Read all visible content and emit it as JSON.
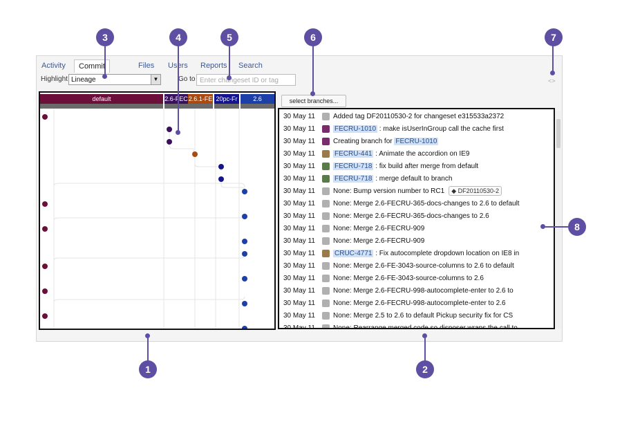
{
  "tabs": [
    "Activity",
    "Commit Graph",
    "Files",
    "Users",
    "Reports",
    "Search"
  ],
  "toolbar": {
    "highlight_label": "Highlight",
    "highlight_value": "Lineage",
    "goto_label": "Go to",
    "goto_placeholder": "Enter changeset ID or tag",
    "select_branches": "select branches..."
  },
  "branches": [
    {
      "label": "default",
      "color": "#6b0f3a"
    },
    {
      "label": "2.6-FEC",
      "color": "#3a0f5e"
    },
    {
      "label": "2.6.1-FE",
      "color": "#a84a12"
    },
    {
      "label": "20pc-Fr",
      "color": "#14148c"
    },
    {
      "label": "2.6",
      "color": "#1c3fa8"
    }
  ],
  "commits": [
    {
      "date": "30 May 11",
      "avatar": "gray",
      "pre": "Added tag DF20110530-2 for changeset e315533a2372",
      "key": "",
      "post": "",
      "tag": ""
    },
    {
      "date": "30 May 11",
      "avatar": "purple",
      "pre": "",
      "key": "FECRU-1010",
      "post": " : make isUserInGroup call the cache first",
      "tag": ""
    },
    {
      "date": "30 May 11",
      "avatar": "purple",
      "pre": "Creating branch for ",
      "key": "FECRU-1010",
      "post": "",
      "tag": ""
    },
    {
      "date": "30 May 11",
      "avatar": "brown",
      "pre": "",
      "key": "FECRU-441",
      "post": " : Animate the accordion on IE9",
      "tag": ""
    },
    {
      "date": "30 May 11",
      "avatar": "green",
      "pre": "",
      "key": "FECRU-718",
      "post": " : fix build after merge from default",
      "tag": ""
    },
    {
      "date": "30 May 11",
      "avatar": "green",
      "pre": "",
      "key": "FECRU-718",
      "post": " : merge default to branch",
      "tag": ""
    },
    {
      "date": "30 May 11",
      "avatar": "gray",
      "pre": "None: Bump version number to RC1",
      "key": "",
      "post": "",
      "tag": "DF20110530-2"
    },
    {
      "date": "30 May 11",
      "avatar": "gray",
      "pre": "None: Merge 2.6-FECRU-365-docs-changes to 2.6 to default",
      "key": "",
      "post": "",
      "tag": ""
    },
    {
      "date": "30 May 11",
      "avatar": "gray",
      "pre": "None: Merge 2.6-FECRU-365-docs-changes to 2.6",
      "key": "",
      "post": "",
      "tag": ""
    },
    {
      "date": "30 May 11",
      "avatar": "gray",
      "pre": "None: Merge 2.6-FECRU-909",
      "key": "",
      "post": "",
      "tag": ""
    },
    {
      "date": "30 May 11",
      "avatar": "gray",
      "pre": "None: Merge 2.6-FECRU-909",
      "key": "",
      "post": "",
      "tag": ""
    },
    {
      "date": "30 May 11",
      "avatar": "brown",
      "pre": "",
      "key": "CRUC-4771",
      "post": " : Fix autocomplete dropdown location on IE8 in",
      "tag": ""
    },
    {
      "date": "30 May 11",
      "avatar": "gray",
      "pre": "None: Merge 2.6-FE-3043-source-columns to 2.6 to default",
      "key": "",
      "post": "",
      "tag": ""
    },
    {
      "date": "30 May 11",
      "avatar": "gray",
      "pre": "None: Merge 2.6-FE-3043-source-columns to 2.6",
      "key": "",
      "post": "",
      "tag": ""
    },
    {
      "date": "30 May 11",
      "avatar": "gray",
      "pre": "None: Merge 2.6-FECRU-998-autocomplete-enter to 2.6 to",
      "key": "",
      "post": "",
      "tag": ""
    },
    {
      "date": "30 May 11",
      "avatar": "gray",
      "pre": "None: Merge 2.6-FECRU-998-autocomplete-enter to 2.6",
      "key": "",
      "post": "",
      "tag": ""
    },
    {
      "date": "30 May 11",
      "avatar": "gray",
      "pre": "None: Merge 2.5 to 2.6 to default Pickup security fix for CS",
      "key": "",
      "post": "",
      "tag": ""
    },
    {
      "date": "30 May 11",
      "avatar": "gray",
      "pre": "None: Rearrange merged code so disposer wraps the call to",
      "key": "",
      "post": "",
      "tag": ""
    }
  ],
  "callouts": [
    "1",
    "2",
    "3",
    "4",
    "5",
    "6",
    "7",
    "8"
  ],
  "colors": {
    "callout": "#5e4fa2",
    "issue_key_bg": "#cfe0f7"
  }
}
